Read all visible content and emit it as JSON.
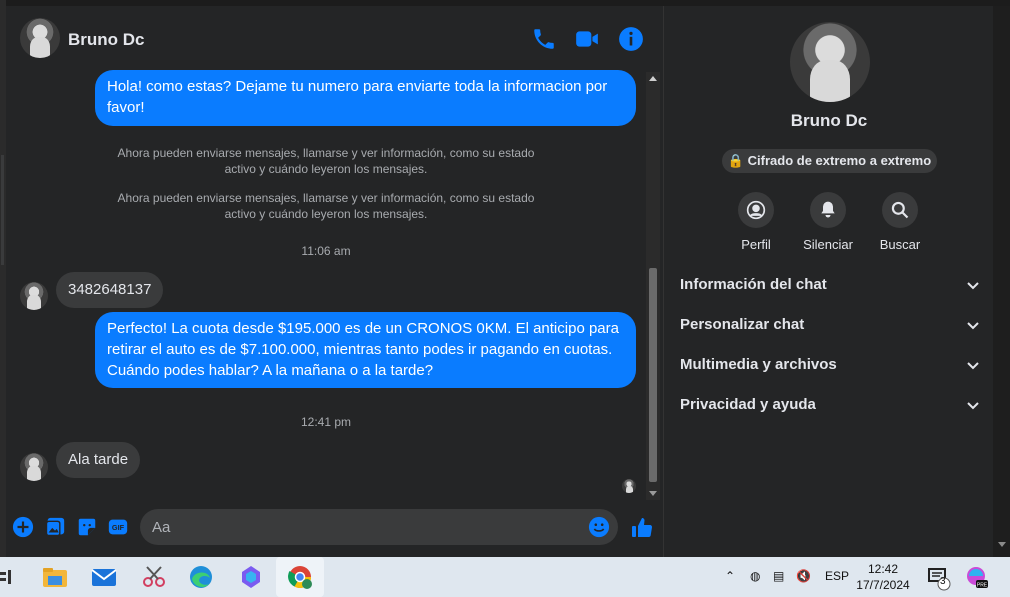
{
  "conversation": {
    "name": "Bruno Dc",
    "messages": [
      {
        "dir": "out",
        "text": "Hola! como estas? Dejame tu numero para enviarte toda la informacion por favor!"
      },
      {
        "dir": "sys",
        "text": "Ahora pueden enviarse mensajes, llamarse y ver información, como su estado activo y cuándo leyeron los mensajes."
      },
      {
        "dir": "sys",
        "text": "Ahora pueden enviarse mensajes, llamarse y ver información, como su estado activo y cuándo leyeron los mensajes."
      },
      {
        "dir": "time",
        "text": "11:06 am"
      },
      {
        "dir": "in",
        "text": "3482648137"
      },
      {
        "dir": "out",
        "text": "Perfecto! La cuota desde $195.000 es de un CRONOS 0KM. El anticipo para retirar el auto es de $7.100.000, mientras tanto podes ir pagando en cuotas. Cuándo podes hablar? A la mañana o a la tarde?"
      },
      {
        "dir": "time",
        "text": "12:41 pm"
      },
      {
        "dir": "in",
        "text": "Ala tarde"
      }
    ]
  },
  "composer": {
    "placeholder": "Aa"
  },
  "header_icons": [
    "phone-icon",
    "video-icon",
    "info-icon"
  ],
  "composer_icons": [
    "plus-icon",
    "image-icon",
    "sticker-icon",
    "gif-icon",
    "emoji-icon",
    "like-icon"
  ],
  "side": {
    "name": "Bruno Dc",
    "e2e_label": "Cifrado de extremo a extremo",
    "actions": [
      {
        "label": "Perfil",
        "icon": "profile-icon"
      },
      {
        "label": "Silenciar",
        "icon": "bell-icon"
      },
      {
        "label": "Buscar",
        "icon": "search-icon"
      }
    ],
    "sections": [
      "Información del chat",
      "Personalizar chat",
      "Multimedia y archivos",
      "Privacidad y ayuda"
    ]
  },
  "taskbar": {
    "apps": [
      "widgets-icon",
      "file-explorer-icon",
      "mail-icon",
      "snipping-tool-icon",
      "edge-icon",
      "copilot-icon",
      "chrome-icon"
    ],
    "lang": "ESP",
    "time": "12:42",
    "date": "17/7/2024",
    "notif_count": "3"
  },
  "colors": {
    "accent": "#0a7cff",
    "bg": "#242526",
    "bubble_in": "#3a3b3c"
  }
}
